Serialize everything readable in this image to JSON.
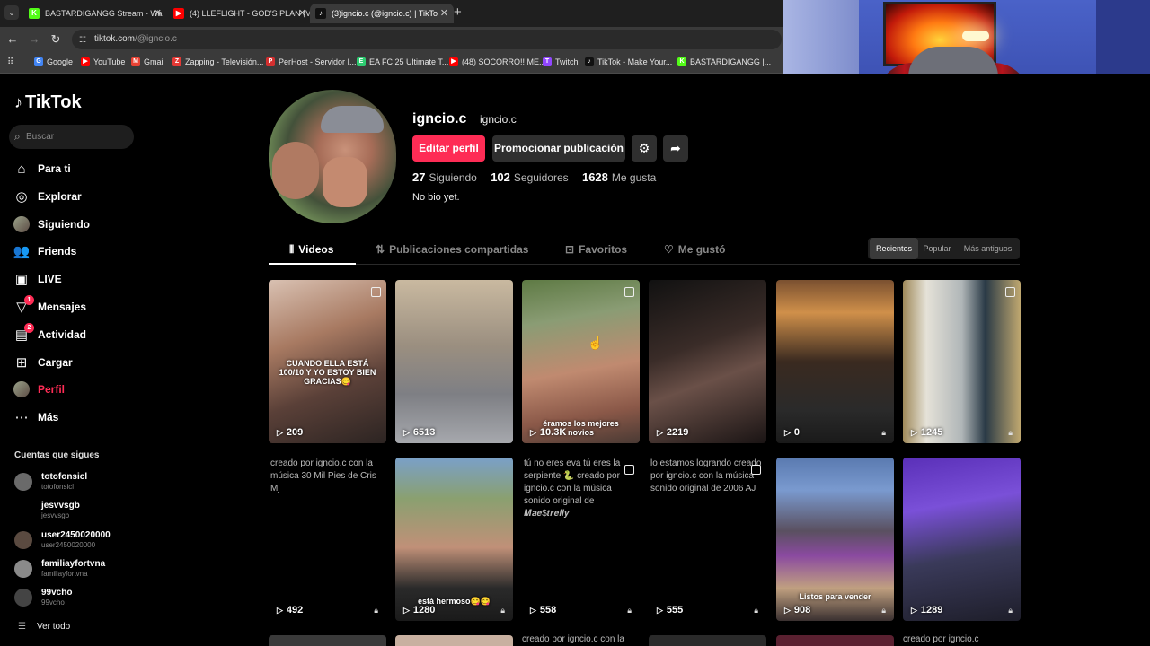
{
  "browser": {
    "tabs": [
      {
        "title": "BASTARDIGANGG Stream - Wa",
        "icon": "K",
        "color": "#53fc18",
        "active": false
      },
      {
        "title": "(4) LLEFLIGHT - GOD'S PLAN (V",
        "icon": "▶",
        "color": "#ff0000",
        "active": false
      },
      {
        "title": "(3)igncio.c (@igncio.c) | TikTo",
        "icon": "♪",
        "color": "#000000",
        "active": true
      }
    ],
    "url_domain": "tiktok.com",
    "url_path": "/@igncio.c",
    "bookmarks": [
      {
        "label": "Google",
        "icon": "G",
        "color": "#4285f4"
      },
      {
        "label": "YouTube",
        "icon": "▶",
        "color": "#ff0000"
      },
      {
        "label": "Gmail",
        "icon": "M",
        "color": "#ea4335"
      },
      {
        "label": "Zapping - Televisión...",
        "icon": "Z",
        "color": "#e53935"
      },
      {
        "label": "PerHost - Servidor I...",
        "icon": "P",
        "color": "#d32f2f"
      },
      {
        "label": "EA FC 25 Ultimate T...",
        "icon": "E",
        "color": "#2ecc71"
      },
      {
        "label": "(48) SOCORRO!! ME...",
        "icon": "▶",
        "color": "#ff0000"
      },
      {
        "label": "Twitch",
        "icon": "T",
        "color": "#9146ff"
      },
      {
        "label": "TikTok - Make Your...",
        "icon": "♪",
        "color": "#000000"
      },
      {
        "label": "BASTARDIGANGG |...",
        "icon": "K",
        "color": "#53fc18"
      }
    ]
  },
  "sidebar": {
    "logo": "TikTok",
    "search_placeholder": "Buscar",
    "nav": [
      {
        "label": "Para ti",
        "icon": "⌂",
        "badge": ""
      },
      {
        "label": "Explorar",
        "icon": "◎",
        "badge": ""
      },
      {
        "label": "Siguiendo",
        "icon": "●",
        "badge": ""
      },
      {
        "label": "Friends",
        "icon": "👥",
        "badge": ""
      },
      {
        "label": "LIVE",
        "icon": "▣",
        "badge": ""
      },
      {
        "label": "Mensajes",
        "icon": "▽",
        "badge": "1"
      },
      {
        "label": "Actividad",
        "icon": "▤",
        "badge": "2"
      },
      {
        "label": "Cargar",
        "icon": "⊞",
        "badge": ""
      },
      {
        "label": "Perfil",
        "icon": "●",
        "badge": ""
      },
      {
        "label": "Más",
        "icon": "⋯",
        "badge": ""
      }
    ],
    "following_title": "Cuentas que sigues",
    "following": [
      {
        "name": "totofonsicl",
        "handle": "totofonsicl"
      },
      {
        "name": "jesvvsgb",
        "handle": "jesvvsgb"
      },
      {
        "name": "user2450020000",
        "handle": "user2450020000"
      },
      {
        "name": "familiayfortvna",
        "handle": "familiayfortvna"
      },
      {
        "name": "99vcho",
        "handle": "99vcho"
      }
    ],
    "see_all": "Ver todo"
  },
  "profile": {
    "username": "igncio.c",
    "nickname": "igncio.c",
    "edit_button": "Editar perfil",
    "promote_button": "Promocionar publicación",
    "following_count": "27",
    "following_label": "Siguiendo",
    "followers_count": "102",
    "followers_label": "Seguidores",
    "likes_count": "1628",
    "likes_label": "Me gusta",
    "bio": "No bio yet."
  },
  "tabs": [
    {
      "label": "Videos",
      "icon": "⦀"
    },
    {
      "label": "Publicaciones compartidas",
      "icon": "⇅"
    },
    {
      "label": "Favoritos",
      "icon": "⊡"
    },
    {
      "label": "Me gustó",
      "icon": "♡"
    }
  ],
  "sort": [
    "Recientes",
    "Popular",
    "Más antiguos"
  ],
  "videos": [
    {
      "views": "209",
      "overlay": "CUANDO ELLA ESTÁ 100/10 Y YO ESTOY BIEN GRACIAS😋",
      "alt": "",
      "locked": false,
      "multi": true,
      "bg": "linear-gradient(160deg,#d9c1b2 0%,#a87a62 35%,#5a4038 65%,#2c2422 100%)"
    },
    {
      "views": "6513",
      "overlay": "",
      "alt": "",
      "locked": false,
      "multi": false,
      "bg": "linear-gradient(180deg,#c9b9a0 0%,#9b8f80 40%,#7e7f84 70%,#a6a8ad 100%)"
    },
    {
      "views": "10.3K",
      "overlay": "éramos los mejores novios",
      "alt": "",
      "locked": false,
      "multi": true,
      "bg": "linear-gradient(170deg,#5e7a44 0%,#8a9c74 25%,#c08a70 55%,#8a5848 80%,#4a3a34 100%)"
    },
    {
      "views": "2219",
      "overlay": "",
      "alt": "",
      "locked": false,
      "multi": false,
      "bg": "linear-gradient(160deg,#111 0%,#3a2c28 40%,#6a5048 60%,#1a1414 100%)"
    },
    {
      "views": "0",
      "overlay": "",
      "alt": "",
      "locked": true,
      "multi": false,
      "bg": "linear-gradient(180deg,#7a5030 0%,#d0904a 20%,#3a2a20 50%,#2a2a2a 80%,#1a1a1a 100%)"
    },
    {
      "views": "1245",
      "overlay": "",
      "alt": "",
      "locked": true,
      "multi": true,
      "bg": "linear-gradient(90deg,#a08a5a 0%,#e5e2d8 20%,#b0b6b8 50%,#2a3a46 70%,#c0a870 100%)"
    },
    {
      "views": "492",
      "overlay": "",
      "alt": "creado por igncio.c con la música 30 Mil Pies de Cris Mj",
      "locked": true,
      "multi": false,
      "bg": ""
    },
    {
      "views": "1280",
      "overlay": "está hermoso😋😋",
      "alt": "",
      "locked": true,
      "multi": false,
      "bg": "linear-gradient(180deg,#7aa0c8 0%,#8aa070 25%,#c09078 55%,#2a2a2a 80%,#1a1a1a 100%)"
    },
    {
      "views": "558",
      "overlay": "",
      "alt": "tú no eres eva tú eres la serpiente 🐍 creado por igncio.c con la música sonido original de 𝑴𝒂𝒆$𝒕𝒓𝒆𝒍𝒍𝒚",
      "locked": true,
      "multi": true,
      "bg": ""
    },
    {
      "views": "555",
      "overlay": "",
      "alt": "lo estamos logrando creado por igncio.c con la música sonido original de 2006 AJ",
      "locked": true,
      "multi": true,
      "bg": ""
    },
    {
      "views": "908",
      "overlay": "Listos para vender",
      "alt": "",
      "locked": true,
      "multi": false,
      "bg": "linear-gradient(180deg,#5a7ab0 0%,#7a9acf 20%,#5a5060 45%,#8a4aa0 60%,#c0a080 80%,#3a3030 100%)"
    },
    {
      "views": "1289",
      "overlay": "",
      "alt": "",
      "locked": true,
      "multi": false,
      "bg": "linear-gradient(170deg,#5a30b8 0%,#7a50d8 30%,#3a3a5a 60%,#1e1e2a 100%)"
    }
  ],
  "row3_partial": [
    "",
    "",
    "creado por igncio.c con la",
    "",
    "",
    "creado por igncio.c"
  ]
}
